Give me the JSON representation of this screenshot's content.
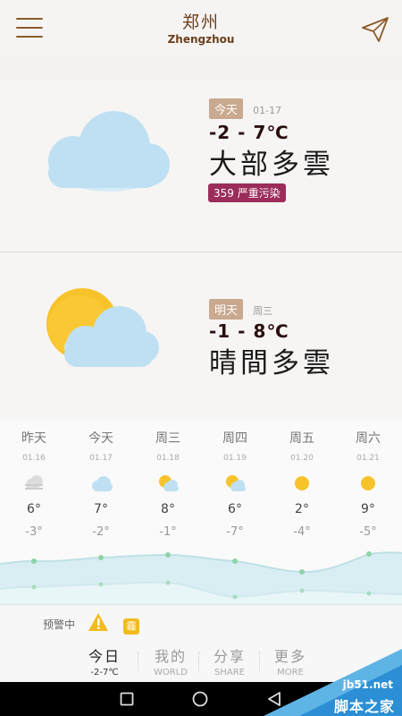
{
  "header": {
    "city": "郑州",
    "city_en": "Zhengzhou"
  },
  "today": {
    "tag": "今天",
    "date": "01-17",
    "temp_range": "-2 - 7℃",
    "condition": "大部多雲",
    "aqi": "359 严重污染"
  },
  "tomorrow": {
    "tag": "明天",
    "weekday": "周三",
    "temp_range": "-1 - 8℃",
    "condition": "晴間多雲"
  },
  "forecast": {
    "days": [
      {
        "name": "昨天",
        "date": "01.16",
        "icon": "haze-cloud-icon",
        "high": "6°",
        "low": "-3°"
      },
      {
        "name": "今天",
        "date": "01.17",
        "icon": "cloud-icon",
        "high": "7°",
        "low": "-2°"
      },
      {
        "name": "周三",
        "date": "01.18",
        "icon": "partly-cloudy-icon",
        "high": "8°",
        "low": "-1°"
      },
      {
        "name": "周四",
        "date": "01.19",
        "icon": "partly-cloudy-icon",
        "high": "6°",
        "low": "-7°"
      },
      {
        "name": "周五",
        "date": "01.20",
        "icon": "sun-icon",
        "high": "2°",
        "low": "-4°"
      },
      {
        "name": "周六",
        "date": "01.21",
        "icon": "sun-icon",
        "high": "9°",
        "low": "-5°"
      }
    ]
  },
  "alerts": {
    "label": "预警中",
    "haze_badge": "霾"
  },
  "nav": [
    {
      "main": "今日",
      "sub": "-2-7℃",
      "active": true
    },
    {
      "main": "我的",
      "sub": "WORLD",
      "active": false
    },
    {
      "main": "分享",
      "sub": "SHARE",
      "active": false
    },
    {
      "main": "更多",
      "sub": "MORE",
      "active": false
    }
  ],
  "watermark": {
    "site": "jb51.net",
    "name": "脚本之家"
  },
  "colors": {
    "accent_brown": "#6a3f1c",
    "tag_bg": "#c9a98f",
    "aqi_bg": "#9b2d5b",
    "cloud": "#bfe0f2",
    "sun": "#f7c32a",
    "warning": "#f2bb1f"
  }
}
